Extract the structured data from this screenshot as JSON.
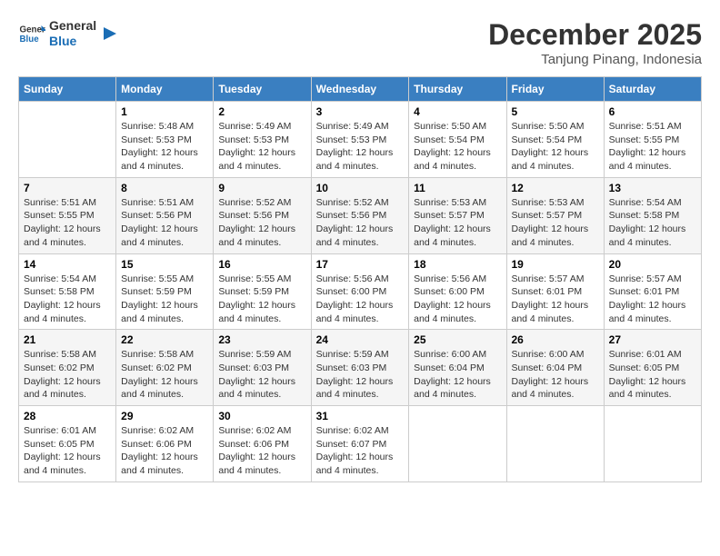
{
  "logo": {
    "text_general": "General",
    "text_blue": "Blue"
  },
  "header": {
    "month": "December 2025",
    "location": "Tanjung Pinang, Indonesia"
  },
  "weekdays": [
    "Sunday",
    "Monday",
    "Tuesday",
    "Wednesday",
    "Thursday",
    "Friday",
    "Saturday"
  ],
  "weeks": [
    [
      {
        "day": "",
        "sunrise": "",
        "sunset": "",
        "daylight": ""
      },
      {
        "day": "1",
        "sunrise": "5:48 AM",
        "sunset": "5:53 PM",
        "daylight": "12 hours and 4 minutes."
      },
      {
        "day": "2",
        "sunrise": "5:49 AM",
        "sunset": "5:53 PM",
        "daylight": "12 hours and 4 minutes."
      },
      {
        "day": "3",
        "sunrise": "5:49 AM",
        "sunset": "5:53 PM",
        "daylight": "12 hours and 4 minutes."
      },
      {
        "day": "4",
        "sunrise": "5:50 AM",
        "sunset": "5:54 PM",
        "daylight": "12 hours and 4 minutes."
      },
      {
        "day": "5",
        "sunrise": "5:50 AM",
        "sunset": "5:54 PM",
        "daylight": "12 hours and 4 minutes."
      },
      {
        "day": "6",
        "sunrise": "5:51 AM",
        "sunset": "5:55 PM",
        "daylight": "12 hours and 4 minutes."
      }
    ],
    [
      {
        "day": "7",
        "sunrise": "5:51 AM",
        "sunset": "5:55 PM",
        "daylight": "12 hours and 4 minutes."
      },
      {
        "day": "8",
        "sunrise": "5:51 AM",
        "sunset": "5:56 PM",
        "daylight": "12 hours and 4 minutes."
      },
      {
        "day": "9",
        "sunrise": "5:52 AM",
        "sunset": "5:56 PM",
        "daylight": "12 hours and 4 minutes."
      },
      {
        "day": "10",
        "sunrise": "5:52 AM",
        "sunset": "5:56 PM",
        "daylight": "12 hours and 4 minutes."
      },
      {
        "day": "11",
        "sunrise": "5:53 AM",
        "sunset": "5:57 PM",
        "daylight": "12 hours and 4 minutes."
      },
      {
        "day": "12",
        "sunrise": "5:53 AM",
        "sunset": "5:57 PM",
        "daylight": "12 hours and 4 minutes."
      },
      {
        "day": "13",
        "sunrise": "5:54 AM",
        "sunset": "5:58 PM",
        "daylight": "12 hours and 4 minutes."
      }
    ],
    [
      {
        "day": "14",
        "sunrise": "5:54 AM",
        "sunset": "5:58 PM",
        "daylight": "12 hours and 4 minutes."
      },
      {
        "day": "15",
        "sunrise": "5:55 AM",
        "sunset": "5:59 PM",
        "daylight": "12 hours and 4 minutes."
      },
      {
        "day": "16",
        "sunrise": "5:55 AM",
        "sunset": "5:59 PM",
        "daylight": "12 hours and 4 minutes."
      },
      {
        "day": "17",
        "sunrise": "5:56 AM",
        "sunset": "6:00 PM",
        "daylight": "12 hours and 4 minutes."
      },
      {
        "day": "18",
        "sunrise": "5:56 AM",
        "sunset": "6:00 PM",
        "daylight": "12 hours and 4 minutes."
      },
      {
        "day": "19",
        "sunrise": "5:57 AM",
        "sunset": "6:01 PM",
        "daylight": "12 hours and 4 minutes."
      },
      {
        "day": "20",
        "sunrise": "5:57 AM",
        "sunset": "6:01 PM",
        "daylight": "12 hours and 4 minutes."
      }
    ],
    [
      {
        "day": "21",
        "sunrise": "5:58 AM",
        "sunset": "6:02 PM",
        "daylight": "12 hours and 4 minutes."
      },
      {
        "day": "22",
        "sunrise": "5:58 AM",
        "sunset": "6:02 PM",
        "daylight": "12 hours and 4 minutes."
      },
      {
        "day": "23",
        "sunrise": "5:59 AM",
        "sunset": "6:03 PM",
        "daylight": "12 hours and 4 minutes."
      },
      {
        "day": "24",
        "sunrise": "5:59 AM",
        "sunset": "6:03 PM",
        "daylight": "12 hours and 4 minutes."
      },
      {
        "day": "25",
        "sunrise": "6:00 AM",
        "sunset": "6:04 PM",
        "daylight": "12 hours and 4 minutes."
      },
      {
        "day": "26",
        "sunrise": "6:00 AM",
        "sunset": "6:04 PM",
        "daylight": "12 hours and 4 minutes."
      },
      {
        "day": "27",
        "sunrise": "6:01 AM",
        "sunset": "6:05 PM",
        "daylight": "12 hours and 4 minutes."
      }
    ],
    [
      {
        "day": "28",
        "sunrise": "6:01 AM",
        "sunset": "6:05 PM",
        "daylight": "12 hours and 4 minutes."
      },
      {
        "day": "29",
        "sunrise": "6:02 AM",
        "sunset": "6:06 PM",
        "daylight": "12 hours and 4 minutes."
      },
      {
        "day": "30",
        "sunrise": "6:02 AM",
        "sunset": "6:06 PM",
        "daylight": "12 hours and 4 minutes."
      },
      {
        "day": "31",
        "sunrise": "6:02 AM",
        "sunset": "6:07 PM",
        "daylight": "12 hours and 4 minutes."
      },
      {
        "day": "",
        "sunrise": "",
        "sunset": "",
        "daylight": ""
      },
      {
        "day": "",
        "sunrise": "",
        "sunset": "",
        "daylight": ""
      },
      {
        "day": "",
        "sunrise": "",
        "sunset": "",
        "daylight": ""
      }
    ]
  ],
  "labels": {
    "sunrise_prefix": "Sunrise: ",
    "sunset_prefix": "Sunset: ",
    "daylight_prefix": "Daylight: "
  }
}
